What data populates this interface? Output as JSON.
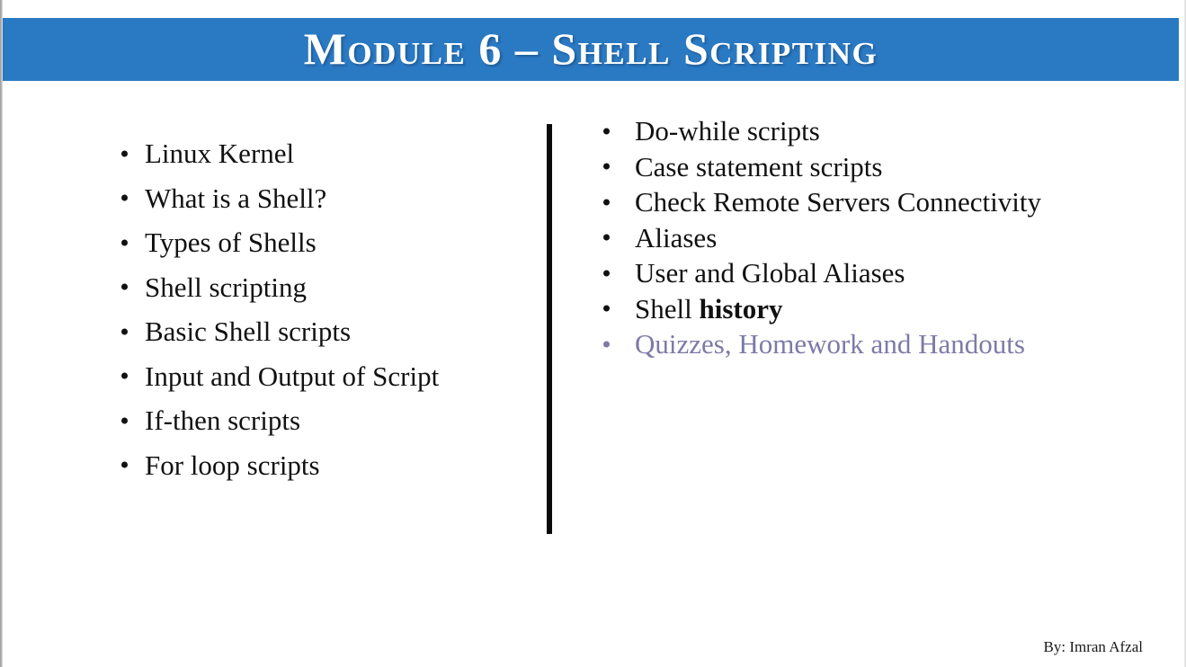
{
  "slide": {
    "title": "Module 6 – Shell Scripting",
    "background_color": "#ffffff",
    "banner_color": "#2a79c3",
    "title_color": "#ffffff",
    "accent_color": "#7d7aa8",
    "divider_color": "#0a0a0a"
  },
  "left_column": {
    "items": [
      {
        "label": "Linux Kernel"
      },
      {
        "label": "What is a Shell?"
      },
      {
        "label": "Types of Shells"
      },
      {
        "label": "Shell scripting"
      },
      {
        "label": "Basic Shell scripts"
      },
      {
        "label": "Input and Output of Script"
      },
      {
        "label": "If-then scripts"
      },
      {
        "label": "For loop scripts"
      }
    ]
  },
  "right_column": {
    "items": [
      {
        "label": "Do-while scripts"
      },
      {
        "label": "Case statement scripts"
      },
      {
        "label": "Check Remote Servers Connectivity"
      },
      {
        "label": "Aliases"
      },
      {
        "label": "User and Global Aliases"
      },
      {
        "label": "Shell history",
        "plain_part": "Shell ",
        "bold_part": "history"
      },
      {
        "label": "Quizzes, Homework and Handouts"
      }
    ]
  },
  "footer": {
    "credit": "By: Imran Afzal"
  }
}
